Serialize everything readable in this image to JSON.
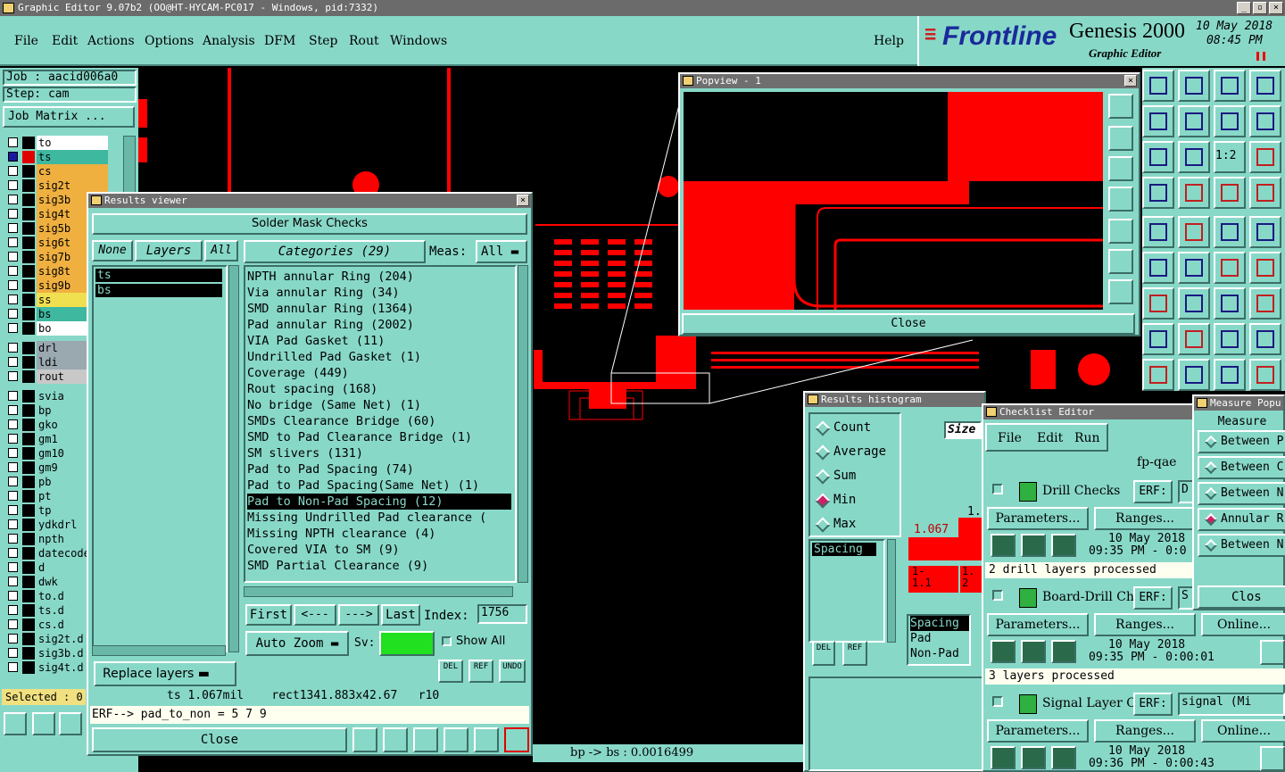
{
  "window": {
    "title": "Graphic Editor 9.07b2 (OO@HT-HYCAM-PC017 - Windows, pid:7332)"
  },
  "menu": [
    "File",
    "Edit",
    "Actions",
    "Options",
    "Analysis",
    "DFM",
    "Step",
    "Rout",
    "Windows"
  ],
  "help_label": "Help",
  "brand": {
    "logo": "Frontline",
    "product": "Genesis 2000",
    "subtitle": "Graphic Editor",
    "date": "10 May 2018",
    "time": "08:45 PM"
  },
  "job": {
    "job_label": "Job : aacid006a0",
    "step_label": "Step: cam",
    "matrix_button": "Job Matrix ..."
  },
  "layers": [
    {
      "name": "to",
      "color": "#000000",
      "bg": "#ffffff",
      "checked": false
    },
    {
      "name": "ts",
      "color": "#e00000",
      "bg": "#3fb8a0",
      "checked": true
    },
    {
      "name": "cs",
      "color": "#000000",
      "bg": "#f0b040",
      "checked": false
    },
    {
      "name": "sig2t",
      "color": "#000000",
      "bg": "#f0b040",
      "checked": false
    },
    {
      "name": "sig3b",
      "color": "#000000",
      "bg": "#f0b040",
      "checked": false
    },
    {
      "name": "sig4t",
      "color": "#000000",
      "bg": "#f0b040",
      "checked": false
    },
    {
      "name": "sig5b",
      "color": "#000000",
      "bg": "#f0b040",
      "checked": false
    },
    {
      "name": "sig6t",
      "color": "#000000",
      "bg": "#f0b040",
      "checked": false
    },
    {
      "name": "sig7b",
      "color": "#000000",
      "bg": "#f0b040",
      "checked": false
    },
    {
      "name": "sig8t",
      "color": "#000000",
      "bg": "#f0b040",
      "checked": false
    },
    {
      "name": "sig9b",
      "color": "#000000",
      "bg": "#f0b040",
      "checked": false
    },
    {
      "name": "ss",
      "color": "#000000",
      "bg": "#f0e050",
      "checked": false
    },
    {
      "name": "bs",
      "color": "#000000",
      "bg": "#3fb8a0",
      "checked": false
    },
    {
      "name": "bo",
      "color": "#000000",
      "bg": "#ffffff",
      "checked": false
    },
    {
      "name": "drl",
      "color": "#000000",
      "bg": "#9aa8b0",
      "checked": false
    },
    {
      "name": "ldi",
      "color": "#000000",
      "bg": "#9aa8b0",
      "checked": false
    },
    {
      "name": "rout",
      "color": "#000000",
      "bg": "#c8c8c8",
      "checked": false
    },
    {
      "name": "svia",
      "color": "#000000",
      "bg": "#88d8c8",
      "checked": false
    },
    {
      "name": "bp",
      "color": "#000000",
      "bg": "#88d8c8",
      "checked": false
    },
    {
      "name": "gko",
      "color": "#000000",
      "bg": "#88d8c8",
      "checked": false
    },
    {
      "name": "gm1",
      "color": "#000000",
      "bg": "#88d8c8",
      "checked": false
    },
    {
      "name": "gm10",
      "color": "#000000",
      "bg": "#88d8c8",
      "checked": false
    },
    {
      "name": "gm9",
      "color": "#000000",
      "bg": "#88d8c8",
      "checked": false
    },
    {
      "name": "pb",
      "color": "#000000",
      "bg": "#88d8c8",
      "checked": false
    },
    {
      "name": "pt",
      "color": "#000000",
      "bg": "#88d8c8",
      "checked": false
    },
    {
      "name": "tp",
      "color": "#000000",
      "bg": "#88d8c8",
      "checked": false
    },
    {
      "name": "ydkdrl",
      "color": "#000000",
      "bg": "#88d8c8",
      "checked": false
    },
    {
      "name": "npth",
      "color": "#000000",
      "bg": "#88d8c8",
      "checked": false
    },
    {
      "name": "datecode",
      "color": "#000000",
      "bg": "#88d8c8",
      "checked": false
    },
    {
      "name": "d",
      "color": "#000000",
      "bg": "#88d8c8",
      "checked": false
    },
    {
      "name": "dwk",
      "color": "#000000",
      "bg": "#88d8c8",
      "checked": false
    },
    {
      "name": "to.d",
      "color": "#000000",
      "bg": "#88d8c8",
      "checked": false
    },
    {
      "name": "ts.d",
      "color": "#000000",
      "bg": "#88d8c8",
      "checked": false
    },
    {
      "name": "cs.d",
      "color": "#000000",
      "bg": "#88d8c8",
      "checked": false
    },
    {
      "name": "sig2t.d",
      "color": "#000000",
      "bg": "#88d8c8",
      "checked": false
    },
    {
      "name": "sig3b.d",
      "color": "#000000",
      "bg": "#88d8c8",
      "checked": false
    },
    {
      "name": "sig4t.d",
      "color": "#000000",
      "bg": "#88d8c8",
      "checked": false
    }
  ],
  "selected_label": "Selected : 0",
  "results_viewer": {
    "title": "Results viewer",
    "header": "Solder Mask Checks",
    "none_btn": "None",
    "layers_btn": "Layers",
    "all_btn": "All",
    "layer_list": [
      "ts",
      "bs"
    ],
    "categories_btn": "Categories (29)",
    "meas_label": "Meas:",
    "meas_value": "All",
    "categories": [
      "NPTH annular Ring (204)",
      "Via annular Ring (34)",
      "SMD annular Ring (1364)",
      "Pad annular Ring (2002)",
      "VIA Pad Gasket (11)",
      "Undrilled Pad Gasket (1)",
      "Coverage (449)",
      "Rout spacing (168)",
      "No bridge (Same Net) (1)",
      "SMDs Clearance Bridge (60)",
      "SMD to Pad Clearance Bridge (1)",
      "SM slivers (131)",
      "Pad to Pad Spacing (74)",
      "Pad to Pad Spacing(Same Net) (1)",
      "Pad to Non-Pad Spacing (12)",
      "Missing Undrilled Pad clearance (",
      "Missing NPTH clearance (4)",
      "Covered VIA to SM (9)",
      "SMD Partial Clearance (9)"
    ],
    "selected_category_index": 14,
    "first_btn": "First",
    "prev_btn": "<---",
    "next_btn": "--->",
    "last_btn": "Last",
    "index_label": "Index:",
    "index_value": "1756",
    "auto_zoom": "Auto Zoom",
    "sv_label": "Sv:",
    "show_all": "Show All",
    "replace_layers": "Replace layers",
    "del_btn": "DEL",
    "ref_btn": "REF",
    "undo_btn": "UNDO",
    "status_line": "ts 1.067mil    rect1341.883x42.67   r10",
    "erf_line": "ERF--> pad_to_non = 5 7 9",
    "close_btn": "Close"
  },
  "popview": {
    "title": "Popview - 1",
    "close_btn": "Close"
  },
  "results_histogram": {
    "title": "Results histogram",
    "options": [
      "Count",
      "Average",
      "Sum",
      "Min",
      "Max"
    ],
    "selected": "Min",
    "size_label": "Size",
    "list": [
      "Spacing"
    ],
    "bar_value": "1.067",
    "bar_label2": "1.",
    "bin_labels": [
      "1-",
      "1.1",
      "1.",
      "2"
    ],
    "legend": [
      "Spacing",
      "Pad",
      "Non-Pad"
    ],
    "del_btn": "DEL",
    "ref_btn": "REF"
  },
  "checklist": {
    "title": "Checklist Editor",
    "menu": [
      "File",
      "Edit",
      "Run"
    ],
    "name": "fp-qae",
    "checks": [
      {
        "name": "Drill Checks",
        "erf": "ERF:",
        "erf_val": "D",
        "params": "Parameters...",
        "ranges": "Ranges...",
        "online": "",
        "date": "10 May 2018",
        "time": "09:35 PM - 0:0",
        "status": "2 drill layers processed"
      },
      {
        "name": "Board-Drill Che",
        "erf": "ERF:",
        "erf_val": "S",
        "params": "Parameters...",
        "ranges": "Ranges...",
        "online": "Online...",
        "date": "10 May 2018",
        "time": "09:35 PM - 0:00:01",
        "status": "3 layers processed"
      },
      {
        "name": "Signal Layer Ch",
        "erf": "ERF:",
        "erf_val": "signal (Mi",
        "params": "Parameters...",
        "ranges": "Ranges...",
        "online": "Online...",
        "date": "10 May 2018",
        "time": "09:36 PM - 0:00:43",
        "status": ""
      }
    ]
  },
  "measure": {
    "title": "Measure Popu",
    "header": "Measure",
    "options": [
      "Between P",
      "Between C",
      "Between N",
      "Annular R",
      "Between N"
    ],
    "selected_index": 3,
    "close_btn": "Clos"
  },
  "status_bar": {
    "text": "bp -> bs : 0.0016499"
  },
  "colors": {
    "accent": "#88d8c8",
    "copper": "#ff0000",
    "background": "#000000",
    "selection": "#000000"
  }
}
